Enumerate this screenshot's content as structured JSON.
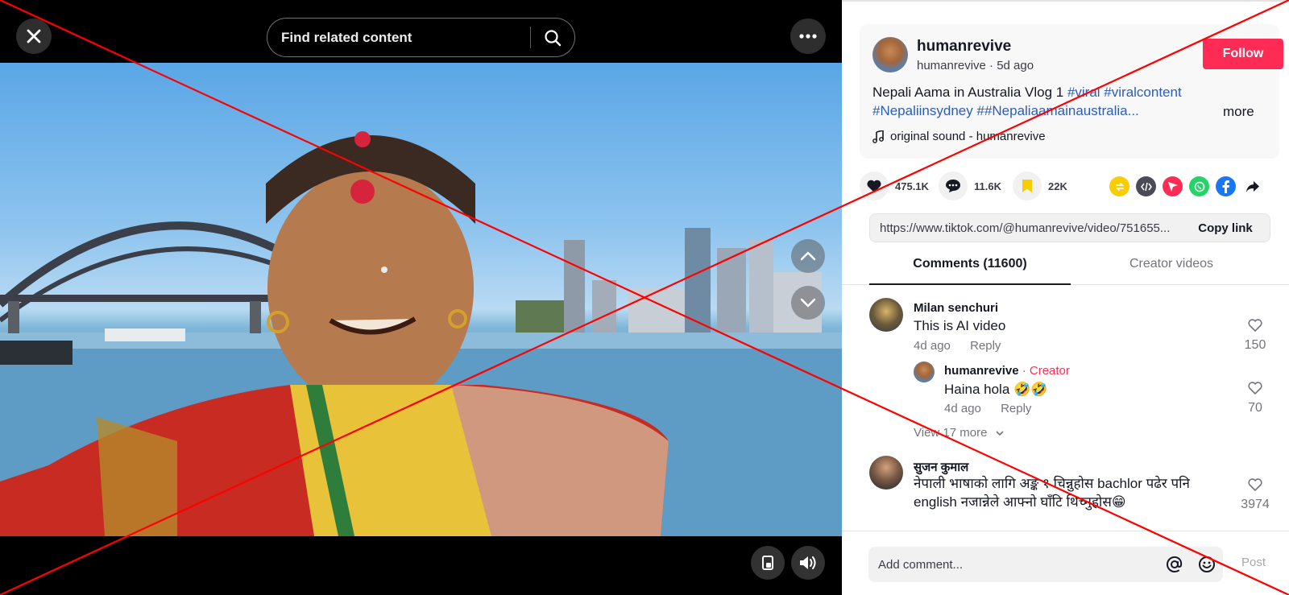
{
  "video": {
    "search_placeholder": "Find related content",
    "icons": {
      "close": "close-icon",
      "search": "search-icon",
      "more": "more-horizontal-icon",
      "up": "chevron-up-icon",
      "down": "chevron-down-icon",
      "pip": "picture-in-picture-icon",
      "volume": "volume-icon"
    }
  },
  "author": {
    "name": "humanrevive",
    "handle_line": "humanrevive · 5d ago",
    "follow_label": "Follow"
  },
  "caption": {
    "text": "Nepali Aama in Australia Vlog 1",
    "hashtags": [
      "#viral",
      "#viralcontent",
      "#Nepaliinsydney",
      "##Nepaliaamainaustralia..."
    ],
    "more_label": "more"
  },
  "sound": {
    "label": "original sound - humanrevive"
  },
  "actions": {
    "likes": "475.1K",
    "comments": "11.6K",
    "saves": "22K",
    "share_icons": [
      "repost-icon",
      "embed-icon",
      "send-icon",
      "whatsapp-icon",
      "facebook-icon",
      "share-arrow-icon"
    ]
  },
  "link": {
    "url": "https://www.tiktok.com/@humanrevive/video/751655...",
    "copy_label": "Copy link"
  },
  "tabs": {
    "comments": "Comments (11600)",
    "creator": "Creator videos"
  },
  "comments": [
    {
      "user": "Milan senchuri",
      "text": "This is AI video",
      "time": "4d ago",
      "reply_label": "Reply",
      "likes": "150"
    },
    {
      "user": "humanrevive",
      "creator_tag": " · Creator",
      "text": "Haina hola 🤣🤣",
      "time": "4d ago",
      "reply_label": "Reply",
      "likes": "70"
    },
    {
      "user": "सुजन कुमाल",
      "text": "नेपाली भाषाको लागि अङ्क १ चिन्नुहोस bachlor पढेर पनि english नजान्नेले आफ्नो घाँटि थिच्नुहोस😁",
      "likes": "3974"
    }
  ],
  "view_more": "View 17 more",
  "comment_bar": {
    "placeholder": "Add comment...",
    "post_label": "Post"
  },
  "colors": {
    "accent": "#fe2c55",
    "hashtag": "#2b5db9",
    "overlay_x": "#ff0000"
  }
}
